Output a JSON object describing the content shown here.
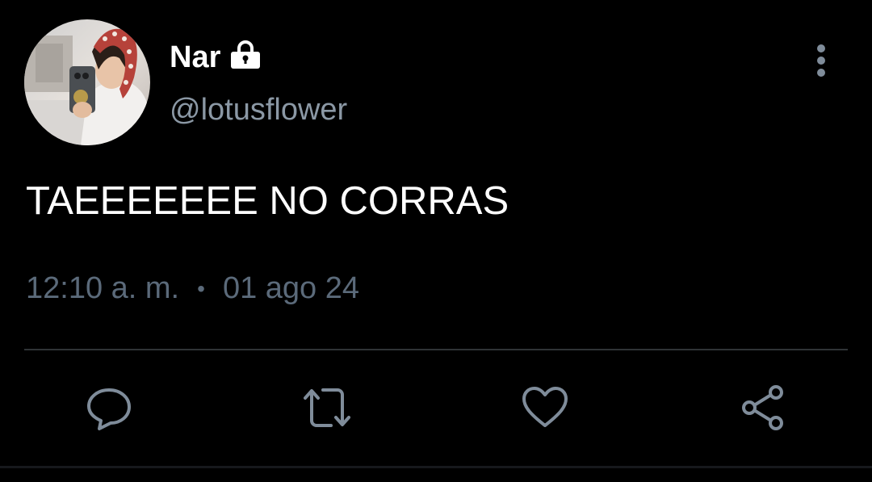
{
  "user": {
    "display_name": "Nar",
    "handle": "@lotusflower",
    "protected": true,
    "avatar": "profile-photo"
  },
  "tweet": {
    "text": "TAEEEEEEE NO CORRAS",
    "time": "12:10 a. m.",
    "separator": "•",
    "date": "01 ago 24"
  },
  "actions": {
    "reply_icon": "speech-bubble-icon",
    "retweet_icon": "retweet-icon",
    "like_icon": "heart-icon",
    "share_icon": "share-icon"
  },
  "colors": {
    "background": "#000000",
    "primary_text": "#ffffff",
    "handle_text": "#8b98a5",
    "meta_text": "#5b6a7a",
    "icon": "#7f8c9a",
    "divider": "#2f3336"
  }
}
